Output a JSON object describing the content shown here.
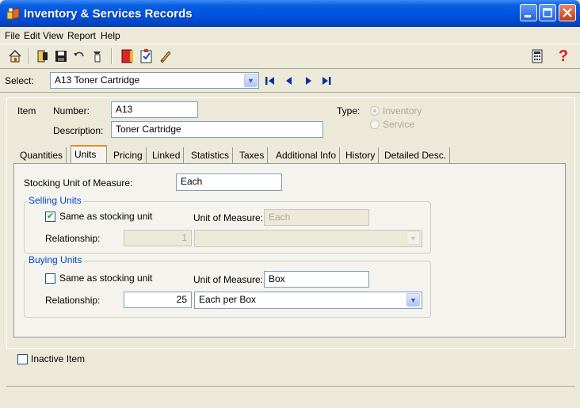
{
  "window": {
    "title": "Inventory & Services Records"
  },
  "menu": {
    "items": [
      "File",
      "Edit",
      "View",
      "Report",
      "Help"
    ]
  },
  "toolbar": {
    "icons": [
      "home-icon",
      "new-record-icon",
      "save-icon",
      "undo-icon",
      "delete-icon",
      "book-icon",
      "clipboard-icon",
      "pencil-icon",
      "calculator-icon",
      "help-icon"
    ]
  },
  "select": {
    "label": "Select:",
    "value": "A13 Toner Cartridge"
  },
  "item": {
    "section_label": "Item",
    "number_label": "Number:",
    "number_value": "A13",
    "description_label": "Description:",
    "description_value": "Toner Cartridge",
    "type_label": "Type:",
    "type_options": [
      "Inventory",
      "Service"
    ],
    "type_selected": "Inventory"
  },
  "tabs": [
    "Quantities",
    "Units",
    "Pricing",
    "Linked",
    "Statistics",
    "Taxes",
    "Additional Info",
    "History",
    "Detailed Desc."
  ],
  "active_tab": "Units",
  "units": {
    "stocking_label": "Stocking Unit of Measure:",
    "stocking_value": "Each",
    "selling": {
      "title": "Selling Units",
      "same_label": "Same as stocking unit",
      "same_checked": true,
      "uom_label": "Unit of Measure:",
      "uom_value": "Each",
      "relationship_label": "Relationship:",
      "relationship_value": "1",
      "relationship_unit": ""
    },
    "buying": {
      "title": "Buying Units",
      "same_label": "Same as stocking unit",
      "same_checked": false,
      "uom_label": "Unit of Measure:",
      "uom_value": "Box",
      "relationship_label": "Relationship:",
      "relationship_value": "25",
      "relationship_unit": "Each per Box"
    }
  },
  "inactive": {
    "label": "Inactive Item",
    "checked": false
  },
  "colors": {
    "title_bar": "#0054e3",
    "group_title": "#0046d5",
    "tab_highlight": "#e68b2c"
  }
}
